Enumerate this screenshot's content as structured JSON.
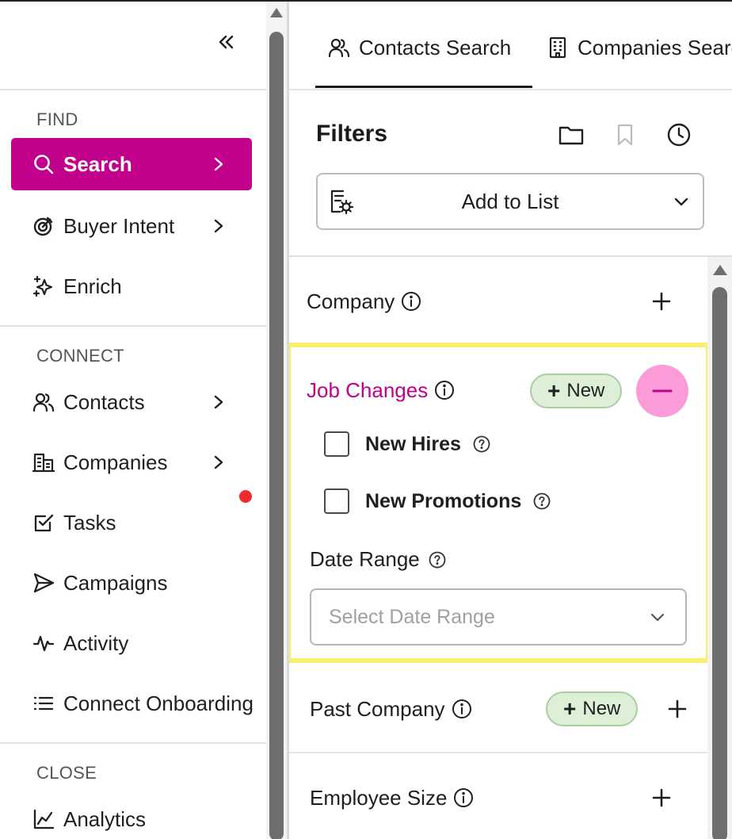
{
  "sidebar": {
    "collapse_icon": "double-chevron-left-icon",
    "sections": {
      "find": "FIND",
      "connect": "CONNECT",
      "close": "CLOSE"
    },
    "items": {
      "search": {
        "label": "Search",
        "icon": "search-icon",
        "active": true
      },
      "buyer_intent": {
        "label": "Buyer Intent",
        "icon": "target-icon"
      },
      "enrich": {
        "label": "Enrich",
        "icon": "sparkle-icon"
      },
      "contacts": {
        "label": "Contacts",
        "icon": "users-icon"
      },
      "companies": {
        "label": "Companies",
        "icon": "building-icon"
      },
      "tasks": {
        "label": "Tasks",
        "icon": "check-square-icon"
      },
      "campaigns": {
        "label": "Campaigns",
        "icon": "send-icon"
      },
      "activity": {
        "label": "Activity",
        "icon": "pulse-icon"
      },
      "connect_onboarding": {
        "label": "Connect Onboarding",
        "icon": "list-icon"
      },
      "analytics": {
        "label": "Analytics",
        "icon": "line-chart-icon"
      }
    },
    "notification_color": "#ef2b2b",
    "accent_color": "#c1008b"
  },
  "tabs": {
    "contacts": {
      "label": "Contacts Search",
      "icon": "users-icon",
      "active": true
    },
    "companies": {
      "label": "Companies Search",
      "icon": "building-icon"
    }
  },
  "filters": {
    "title": "Filters",
    "toolbar_icons": [
      "folder-icon",
      "bookmark-icon",
      "clock-icon"
    ],
    "list_select": {
      "label": "Add to List",
      "icon": "list-settings-icon"
    },
    "company": {
      "label": "Company"
    },
    "job_changes": {
      "label": "Job Changes",
      "new_label": "New",
      "options": {
        "new_hires": "New Hires",
        "new_promotions": "New Promotions"
      },
      "date_range_label": "Date Range",
      "date_range_placeholder": "Select Date Range"
    },
    "past_company": {
      "label": "Past Company",
      "new_label": "New"
    },
    "employee_size": {
      "label": "Employee Size"
    }
  }
}
